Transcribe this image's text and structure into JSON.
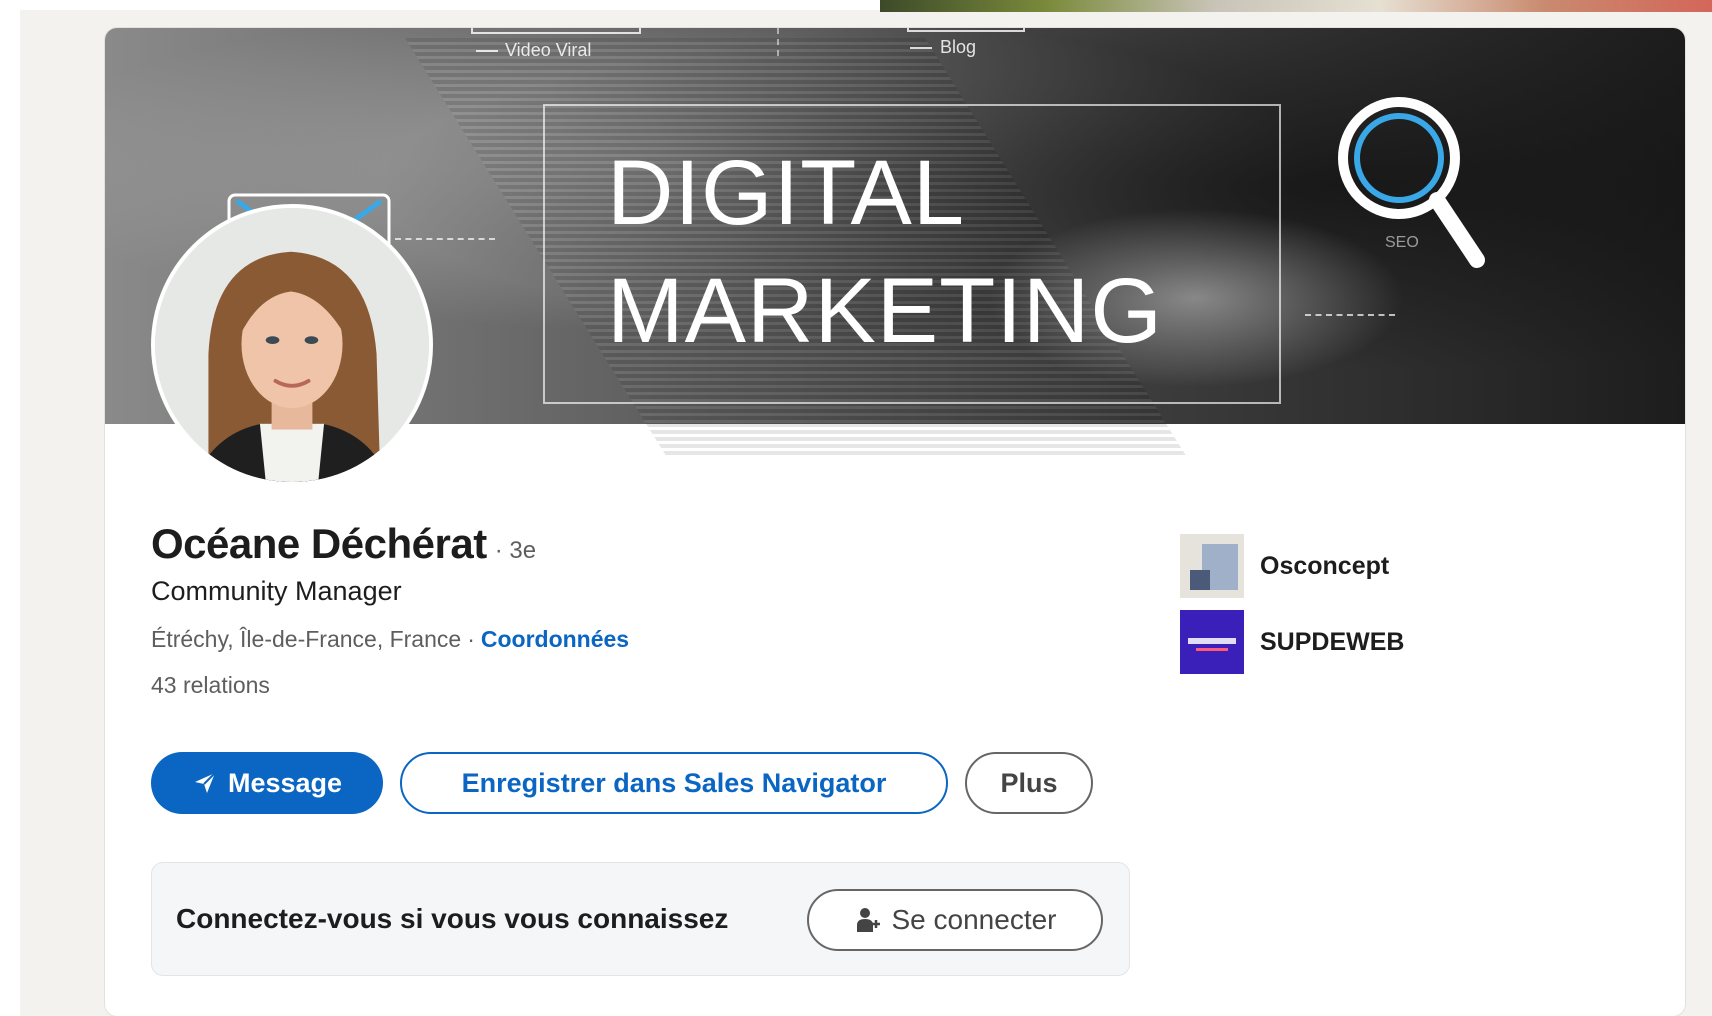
{
  "banner": {
    "headline_line1": "DIGITAL",
    "headline_line2": "MARKETING",
    "tag_video": "Video Viral",
    "tag_blog": "Blog",
    "tag_seo": "SEO"
  },
  "profile": {
    "name": "Océane Déchérat",
    "degree": "· 3e",
    "headline": "Community Manager",
    "location": "Étréchy, Île-de-France, France",
    "location_separator": "·",
    "contact_link": "Coordonnées",
    "connections": "43 relations"
  },
  "actions": {
    "message_label": "Message",
    "sales_nav_label": "Enregistrer dans Sales Navigator",
    "more_label": "Plus"
  },
  "connect_prompt": {
    "text": "Connectez-vous si vous vous connaissez",
    "button_label": "Se connecter"
  },
  "companies": [
    {
      "name": "Osconcept",
      "logo_icon": "osconcept-logo"
    },
    {
      "name": "SUPDEWEB",
      "logo_icon": "supdeweb-logo",
      "logo_color": "#3a1fb8"
    }
  ],
  "colors": {
    "brand_blue": "#0a66c2",
    "page_background": "#f3f2ee"
  }
}
